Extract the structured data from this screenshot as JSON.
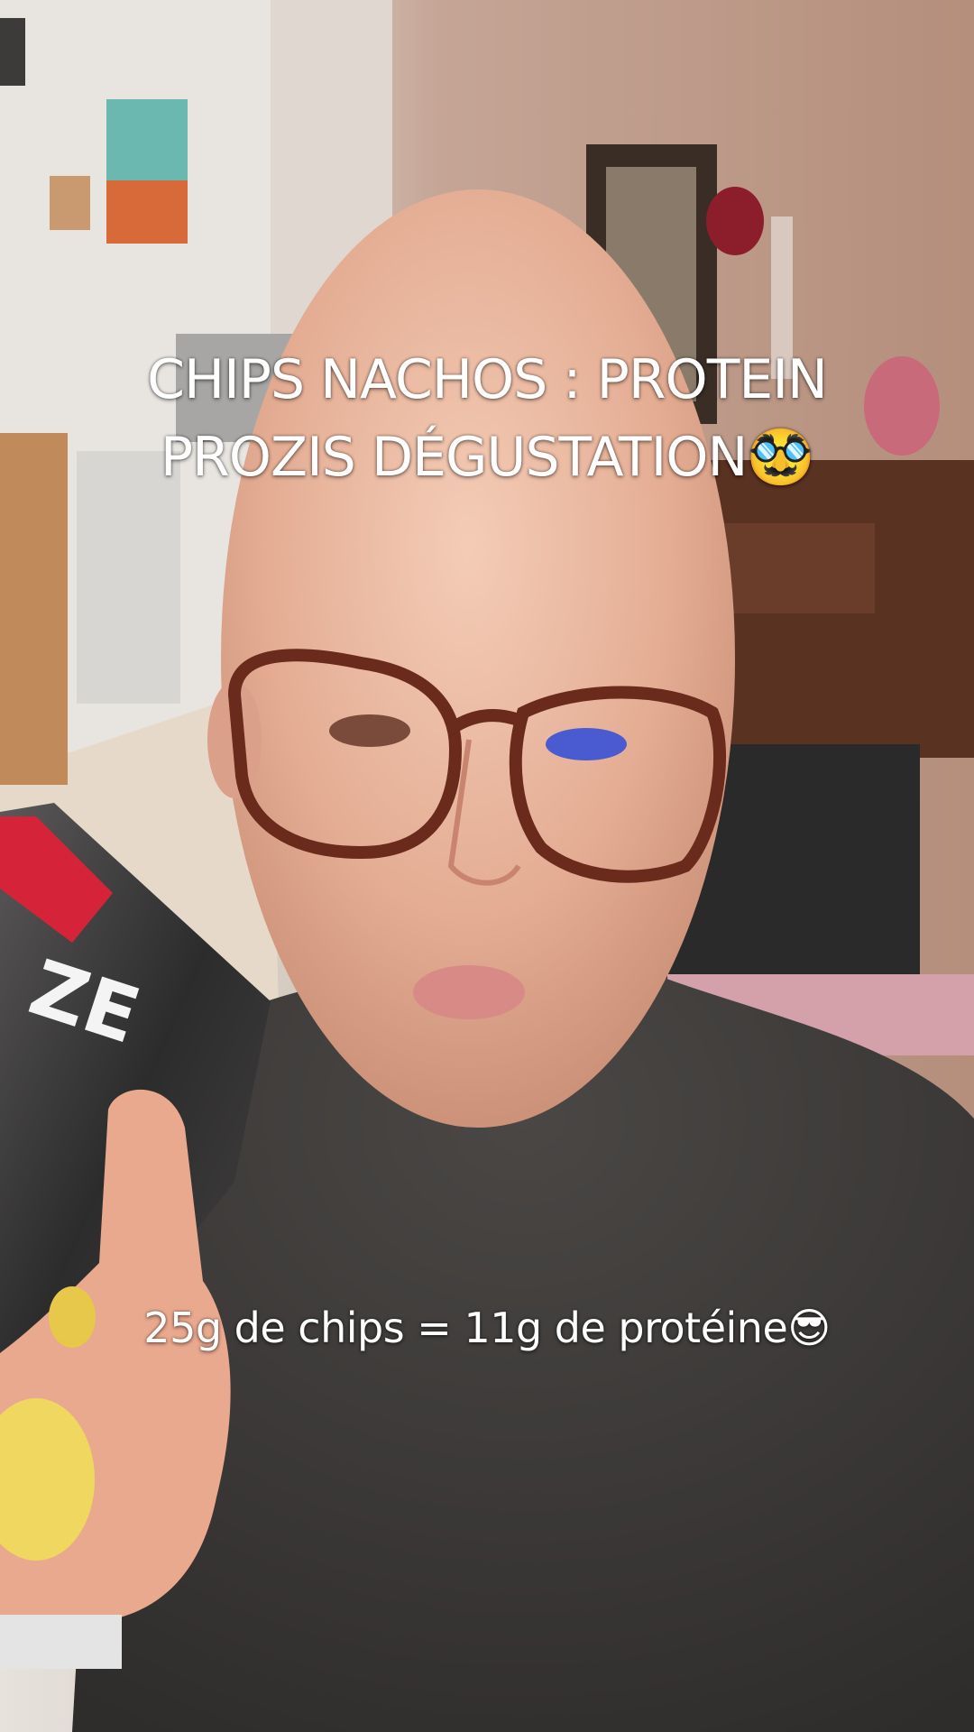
{
  "captions": {
    "title_line1": "CHIPS NACHOS : PROTEIN",
    "title_line2": "PROZIS DÉGUSTATION🥸",
    "subtitle": "25g de chips = 11g de protéine😎"
  },
  "colors": {
    "sweater": "#3b3937",
    "skin": "#e7b59c",
    "wall": "#c9a592",
    "chip_bag_red": "#d5243a",
    "chip_yellow": "#e8c84a"
  }
}
